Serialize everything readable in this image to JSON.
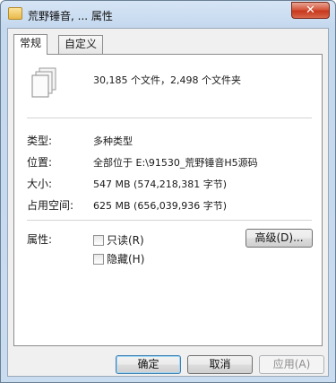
{
  "window": {
    "title": "荒野锤音, ... 属性",
    "close_label": "✕"
  },
  "tabs": [
    {
      "label": "常规"
    },
    {
      "label": "自定义"
    }
  ],
  "general": {
    "summary": "30,185 个文件，2,498 个文件夹",
    "file_icon": "documents-icon",
    "rows": [
      {
        "label": "类型:",
        "value": "多种类型"
      },
      {
        "label": "位置:",
        "value": "全部位于 E:\\91530_荒野锤音H5源码"
      },
      {
        "label": "大小:",
        "value": "547 MB (574,218,381 字节)"
      },
      {
        "label": "占用空间:",
        "value": "625 MB (656,039,936 字节)"
      }
    ],
    "attributes_label": "属性:",
    "readonly_label": "只读(R)",
    "hidden_label": "隐藏(H)",
    "advanced_button": "高级(D)..."
  },
  "footer": {
    "ok": "确定",
    "cancel": "取消",
    "apply": "应用(A)"
  }
}
